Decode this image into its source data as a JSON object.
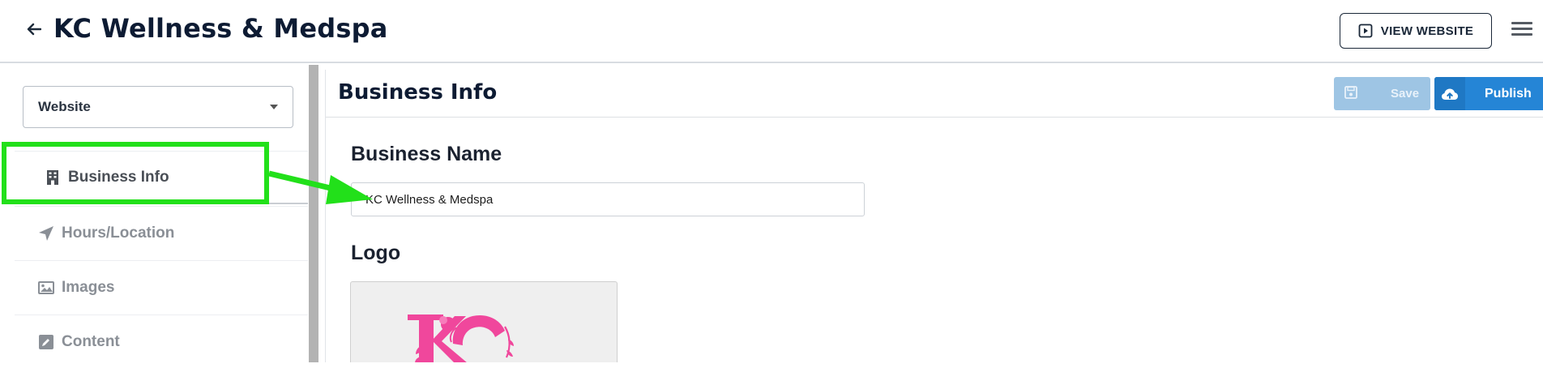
{
  "header": {
    "title": "KC Wellness & Medspa",
    "back_icon": "arrow-left-icon",
    "view_website_label": "VIEW WEBSITE",
    "view_website_icon": "play-square-icon",
    "menu_icon": "hamburger-icon"
  },
  "sidebar": {
    "selector": {
      "value": "Website"
    },
    "items": [
      {
        "label": "Business Info",
        "icon": "building-icon",
        "active": true
      },
      {
        "label": "Hours/Location",
        "icon": "location-arrow-icon",
        "active": false
      },
      {
        "label": "Images",
        "icon": "image-icon",
        "active": false
      },
      {
        "label": "Content",
        "icon": "edit-icon",
        "active": false
      }
    ]
  },
  "main": {
    "title": "Business Info",
    "save_label": "Save",
    "publish_label": "Publish",
    "business_name_label": "Business Name",
    "business_name_value": "KC Wellness & Medspa",
    "logo_label": "Logo"
  },
  "colors": {
    "annotation_green": "#22e01a",
    "publish_blue": "#2585d6",
    "save_disabled_blue": "#9ec5e4",
    "logo_pink": "#f0479c"
  }
}
